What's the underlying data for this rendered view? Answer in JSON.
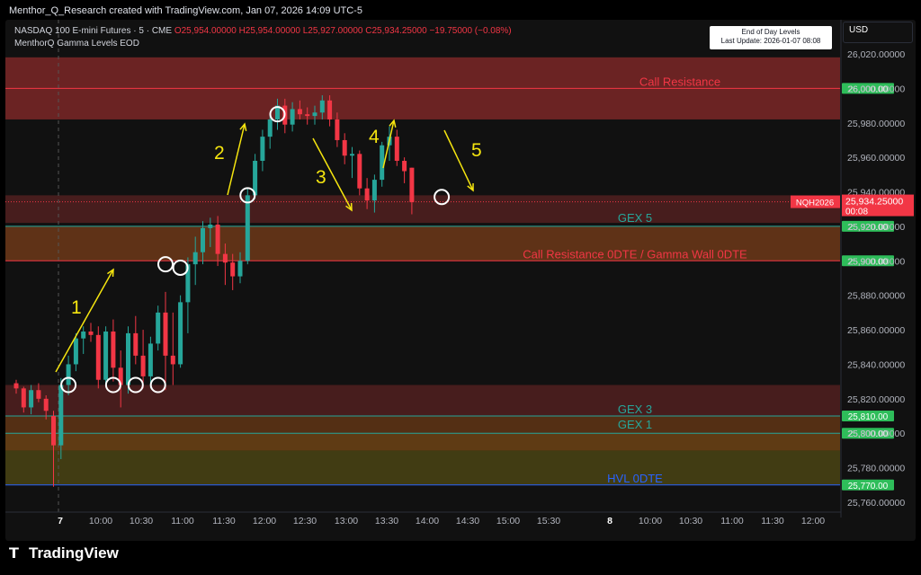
{
  "header": "Menthor_Q_Research created with TradingView.com, Jan 07, 2026 14:09 UTC-5",
  "legend": {
    "symbol": "NASDAQ 100 E-mini Futures · 5 · CME",
    "open": "O25,954.00000",
    "high": "H25,954.00000",
    "low": "L25,927.00000",
    "close": "C25,934.25000",
    "change": "−19.75000 (−0.08%)",
    "indicator": "MenthorQ Gamma Levels EOD"
  },
  "info_box": {
    "line1": "End of Day Levels",
    "line2": "Last Update: 2026-01-07 08:08"
  },
  "currency": "USD",
  "footer": {
    "brand": "TradingView",
    "logo_icon": "tradingview-logo-icon"
  },
  "colors": {
    "up": "#26a69a",
    "down": "#f23645",
    "background": "#111111",
    "level_red": "#f23645",
    "level_teal": "#26a69a",
    "level_orange": "#b8632a",
    "level_blue": "#2962ff",
    "annotation": "#f5e50f",
    "badge_green": "#2ebd5a"
  },
  "chart_data": {
    "type": "candlestick",
    "symbol": "NQH2026",
    "interval": "5",
    "ylim": [
      25760,
      26020
    ],
    "y_ticks": [
      "25,760.00000",
      "25,780.00000",
      "25,800.00000",
      "25,820.00000",
      "25,840.00000",
      "25,860.00000",
      "25,880.00000",
      "25,900.00000",
      "25,920.00000",
      "25,940.00000",
      "25,960.00000",
      "25,980.00000",
      "26,000.00000",
      "26,020.00000"
    ],
    "x_ticks": [
      "7",
      "10:00",
      "10:30",
      "11:00",
      "11:30",
      "12:00",
      "12:30",
      "13:00",
      "13:30",
      "14:00",
      "14:30",
      "15:00",
      "15:30",
      "8",
      "10:00",
      "10:30",
      "11:00",
      "11:30",
      "12:00"
    ],
    "candles": [
      [
        25829,
        25831,
        25823,
        25826
      ],
      [
        25826,
        25827,
        25812,
        25815
      ],
      [
        25815,
        25828,
        25811,
        25825
      ],
      [
        25825,
        25829,
        25818,
        25820
      ],
      [
        25820,
        25822,
        25808,
        25813
      ],
      [
        25810,
        25813,
        25769,
        25793
      ],
      [
        25793,
        25832,
        25785,
        25828
      ],
      [
        25828,
        25845,
        25822,
        25840
      ],
      [
        25840,
        25858,
        25836,
        25855
      ],
      [
        25855,
        25862,
        25846,
        25859
      ],
      [
        25859,
        25864,
        25853,
        25857
      ],
      [
        25857,
        25862,
        25826,
        25831
      ],
      [
        25831,
        25862,
        25828,
        25859
      ],
      [
        25859,
        25866,
        25830,
        25838
      ],
      [
        25838,
        25848,
        25815,
        25828
      ],
      [
        25828,
        25862,
        25823,
        25858
      ],
      [
        25858,
        25868,
        25840,
        25845
      ],
      [
        25845,
        25860,
        25826,
        25833
      ],
      [
        25833,
        25856,
        25826,
        25852
      ],
      [
        25852,
        25874,
        25848,
        25870
      ],
      [
        25870,
        25882,
        25825,
        25845
      ],
      [
        25845,
        25870,
        25828,
        25840
      ],
      [
        25840,
        25880,
        25838,
        25876
      ],
      [
        25876,
        25902,
        25858,
        25898
      ],
      [
        25898,
        25914,
        25886,
        25905
      ],
      [
        25905,
        25923,
        25898,
        25919
      ],
      [
        25919,
        25925,
        25908,
        25921
      ],
      [
        25921,
        25926,
        25897,
        25904
      ],
      [
        25904,
        25910,
        25886,
        25899
      ],
      [
        25899,
        25904,
        25883,
        25891
      ],
      [
        25891,
        25905,
        25887,
        25900
      ],
      [
        25900,
        25942,
        25898,
        25938
      ],
      [
        25938,
        25962,
        25936,
        25958
      ],
      [
        25958,
        25976,
        25952,
        25972
      ],
      [
        25972,
        25985,
        25965,
        25982
      ],
      [
        25982,
        25994,
        25976,
        25990
      ],
      [
        25990,
        25994,
        25974,
        25979
      ],
      [
        25979,
        25992,
        25975,
        25988
      ],
      [
        25988,
        25993,
        25982,
        25985
      ],
      [
        25985,
        25989,
        25979,
        25984
      ],
      [
        25984,
        25990,
        25979,
        25986
      ],
      [
        25986,
        25996,
        25982,
        25993
      ],
      [
        25993,
        25996,
        25978,
        25982
      ],
      [
        25982,
        25986,
        25966,
        25970
      ],
      [
        25970,
        25974,
        25956,
        25961
      ],
      [
        25961,
        25966,
        25948,
        25962
      ],
      [
        25962,
        25964,
        25938,
        25942
      ],
      [
        25942,
        25948,
        25930,
        25935
      ],
      [
        25935,
        25950,
        25928,
        25947
      ],
      [
        25947,
        25969,
        25943,
        25967
      ],
      [
        25967,
        25978,
        25958,
        25972
      ],
      [
        25972,
        25976,
        25955,
        25958
      ],
      [
        25958,
        25960,
        25945,
        25952
      ],
      [
        25954,
        25954,
        25927,
        25934
      ]
    ],
    "levels": [
      {
        "label": "Call Resistance",
        "price": 26000.0,
        "badge": "26,000.00",
        "color": "#f23645",
        "label_color": "#f23645",
        "zone": [
          25982,
          26018
        ],
        "zone_color": "#8a2a2a"
      },
      {
        "label": "GEX 5",
        "price": 25920.0,
        "badge": "25,920.00",
        "color": "#26a69a",
        "label_color": "#26a69a",
        "zone": [
          25922,
          25938
        ],
        "zone_color": "#5a2222"
      },
      {
        "label": "Call Resistance 0DTE / Gamma Wall 0DTE",
        "price": 25900.0,
        "badge": "25,900.00",
        "color": "#f23645",
        "label_color": "#f23645",
        "zone": [
          25900,
          25920
        ],
        "zone_color": "#7a3d1a"
      },
      {
        "label": "GEX 3",
        "price": 25810.0,
        "badge": "25,810.00",
        "color": "#26a69a",
        "label_color": "#26a69a",
        "zone": [
          25810,
          25828
        ],
        "zone_color": "#5a2222"
      },
      {
        "label": "GEX 1",
        "price": 25800.0,
        "badge": "25,800.00",
        "color": "#26a69a",
        "label_color": "#26a69a",
        "zone": [
          25800,
          25810
        ],
        "zone_color": "#6b3a16"
      },
      {
        "label": "HVL 0DTE",
        "price": 25770.0,
        "badge": "25,770.00",
        "color": "#2962ff",
        "label_color": "#2962ff",
        "zone": [
          25790,
          25800
        ],
        "zone_color": "#7a4a16"
      }
    ],
    "olive_zone": [
      25770,
      25790
    ],
    "current_price": {
      "ticker": "NQH2026",
      "value": "25,934.25000",
      "countdown": "00:08"
    },
    "annotations": [
      "1",
      "2",
      "3",
      "4",
      "5"
    ]
  }
}
